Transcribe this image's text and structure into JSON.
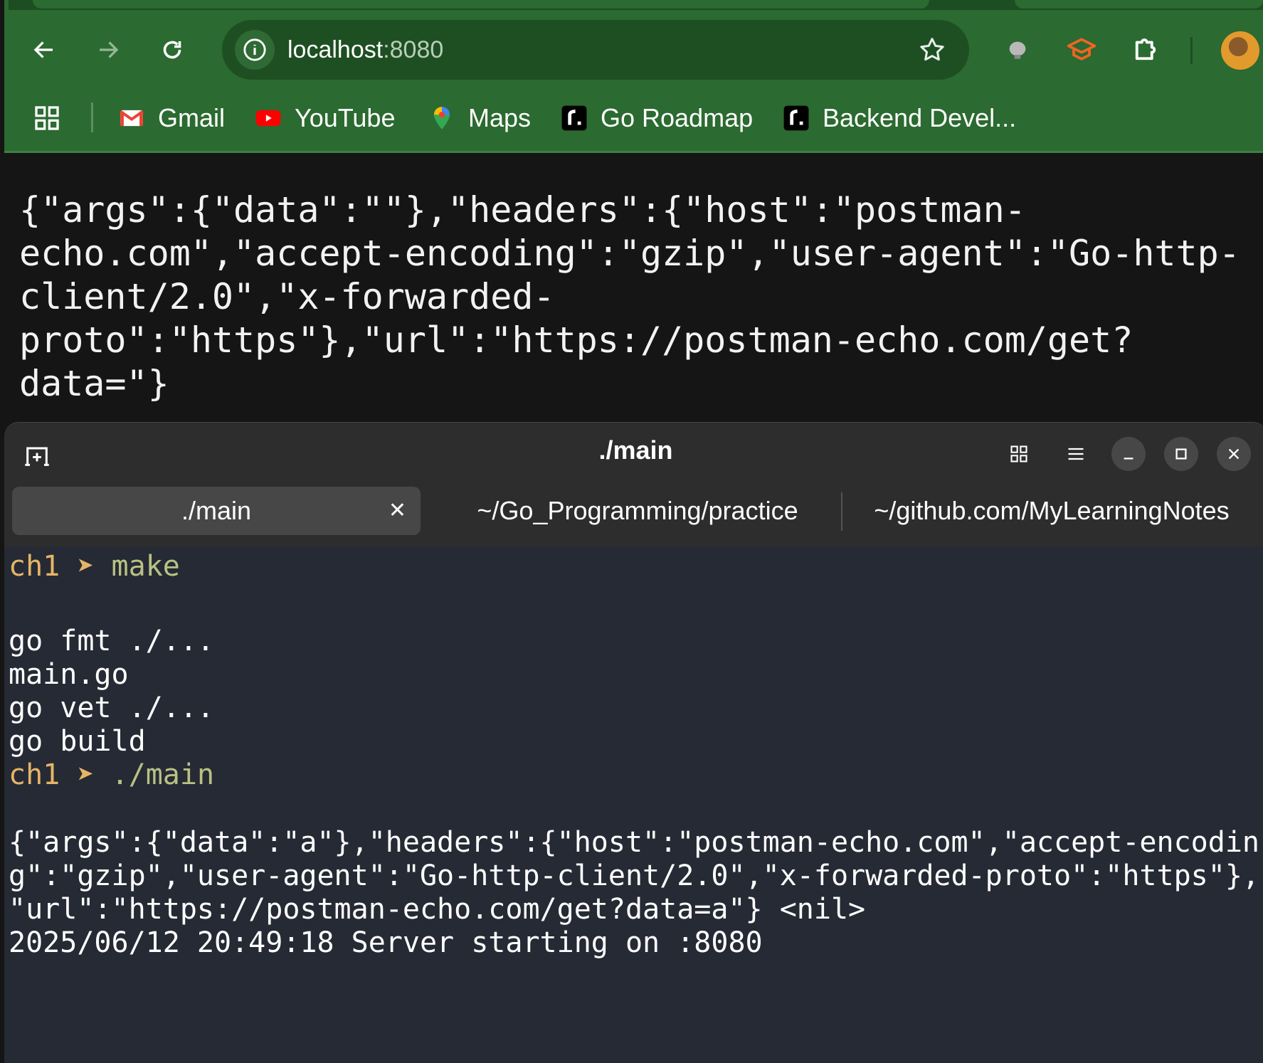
{
  "browser": {
    "url_host": "localhost",
    "url_port": ":8080",
    "bookmarks": [
      {
        "label": "Gmail",
        "icon": "gmail-icon"
      },
      {
        "label": "YouTube",
        "icon": "youtube-icon"
      },
      {
        "label": "Maps",
        "icon": "maps-icon"
      },
      {
        "label": "Go Roadmap",
        "icon": "roadmap-icon"
      },
      {
        "label": "Backend Devel...",
        "icon": "roadmap-icon"
      }
    ],
    "colors": {
      "toolbar": "#2b6a30",
      "omnibox": "#1e4f22"
    }
  },
  "page": {
    "json_lines": [
      "{\"args\":{\"data\":\"\"},\"headers\":{\"host\":\"postman-",
      "echo.com\",\"accept-encoding\":\"gzip\",\"user-agent\":\"Go-http-",
      "client/2.0\",\"x-forwarded-",
      "proto\":\"https\"},\"url\":\"https://postman-echo.com/get?",
      "data=\"}"
    ]
  },
  "terminal": {
    "title": "./main",
    "tabs": [
      {
        "label": "./main",
        "active": true
      },
      {
        "label": "~/Go_Programming/practice",
        "active": false
      },
      {
        "label": "~/github.com/MyLearningNotes",
        "active": false
      }
    ],
    "lines": [
      {
        "type": "prompt",
        "dir": "ch1",
        "arrow": "➤",
        "cmd": "make"
      },
      {
        "type": "blank",
        "text": ""
      },
      {
        "type": "output",
        "text": "go fmt ./..."
      },
      {
        "type": "output",
        "text": "main.go"
      },
      {
        "type": "output",
        "text": "go vet ./..."
      },
      {
        "type": "output",
        "text": "go build"
      },
      {
        "type": "prompt",
        "dir": "ch1",
        "arrow": "➤",
        "cmd": "./main"
      },
      {
        "type": "blank",
        "text": ""
      },
      {
        "type": "output",
        "text": "{\"args\":{\"data\":\"a\"},\"headers\":{\"host\":\"postman-echo.com\",\"accept-encodin"
      },
      {
        "type": "output",
        "text": "g\":\"gzip\",\"user-agent\":\"Go-http-client/2.0\",\"x-forwarded-proto\":\"https\"},"
      },
      {
        "type": "output",
        "text": "\"url\":\"https://postman-echo.com/get?data=a\"} <nil>"
      },
      {
        "type": "output",
        "text": "2025/06/12 20:49:18 Server starting on :8080"
      }
    ],
    "colors": {
      "background": "#262a34",
      "prompt": "#e5b566",
      "command": "#b9c184"
    }
  }
}
